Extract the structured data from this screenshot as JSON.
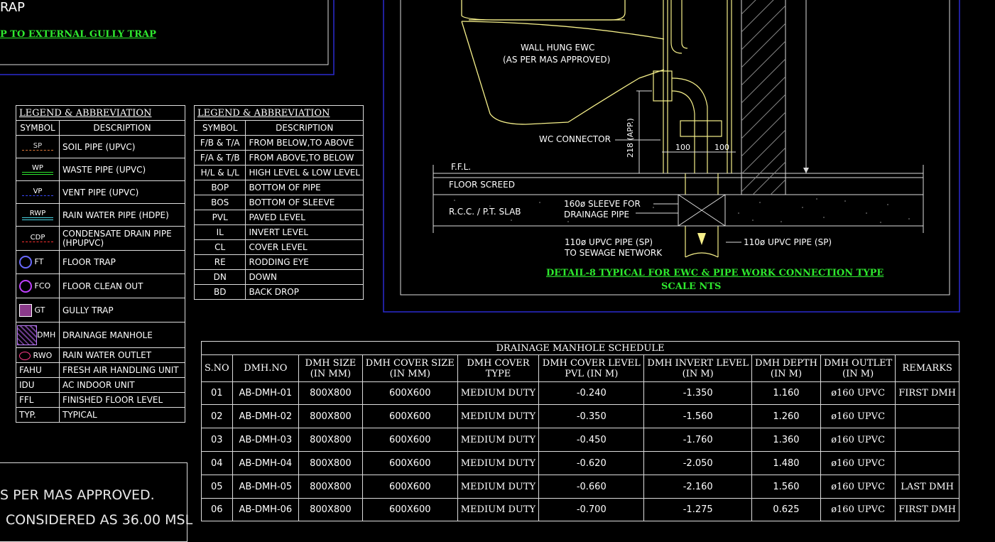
{
  "top_left": {
    "title_fragment": "RAP",
    "link_text": "P TO EXTERNAL GULLY TRAP"
  },
  "legend1": {
    "title": "LEGEND & ABBREVIATION",
    "col_symbol": "SYMBOL",
    "col_description": "DESCRIPTION",
    "rows": [
      {
        "symbol": "SP",
        "description": "SOIL PIPE (UPVC)"
      },
      {
        "symbol": "WP",
        "description": "WASTE PIPE (UPVC)"
      },
      {
        "symbol": "VP",
        "description": "VENT PIPE (UPVC)"
      },
      {
        "symbol": "RWP",
        "description": "RAIN WATER PIPE (HDPE)"
      },
      {
        "symbol": "CDP",
        "description": "CONDENSATE DRAIN PIPE (HPUPVC)"
      },
      {
        "symbol": "FT",
        "description": "FLOOR TRAP"
      },
      {
        "symbol": "FCO",
        "description": "FLOOR CLEAN OUT"
      },
      {
        "symbol": "GT",
        "description": "GULLY TRAP"
      },
      {
        "symbol": "DMH",
        "description": "DRAINAGE MANHOLE"
      },
      {
        "symbol": "RWO",
        "description": "RAIN WATER OUTLET"
      },
      {
        "symbol": "FAHU",
        "description": "FRESH AIR HANDLING UNIT"
      },
      {
        "symbol": "IDU",
        "description": "AC INDOOR UNIT"
      },
      {
        "symbol": "FFL",
        "description": "FINISHED FLOOR LEVEL"
      },
      {
        "symbol": "TYP.",
        "description": "TYPICAL"
      }
    ]
  },
  "legend2": {
    "title": "LEGEND & ABBREVIATION",
    "col_symbol": "SYMBOL",
    "col_description": "DESCRIPTION",
    "rows": [
      {
        "symbol": "F/B & T/A",
        "description": "FROM BELOW,TO ABOVE"
      },
      {
        "symbol": "F/A & T/B",
        "description": "FROM ABOVE,TO BELOW"
      },
      {
        "symbol": "H/L & L/L",
        "description": "HIGH LEVEL & LOW LEVEL"
      },
      {
        "symbol": "BOP",
        "description": "BOTTOM OF PIPE"
      },
      {
        "symbol": "BOS",
        "description": "BOTTOM OF SLEEVE"
      },
      {
        "symbol": "PVL",
        "description": "PAVED LEVEL"
      },
      {
        "symbol": "IL",
        "description": "INVERT LEVEL"
      },
      {
        "symbol": "CL",
        "description": "COVER LEVEL"
      },
      {
        "symbol": "RE",
        "description": "RODDING EYE"
      },
      {
        "symbol": "DN",
        "description": "DOWN"
      },
      {
        "symbol": "BD",
        "description": "BACK DROP"
      }
    ]
  },
  "detail": {
    "wall_hung_label_1": "WALL HUNG EWC",
    "wall_hung_label_2": "(AS PER MAS APPROVED)",
    "wc_connector": "WC CONNECTOR",
    "dim_vertical": "218 (APP.)",
    "dim_100_a": "100",
    "dim_100_b": "100",
    "ffl": "F.F.L.",
    "floor_screed": "FLOOR SCREED",
    "slab": "R.C.C. / P.T. SLAB",
    "sleeve_1": "160ø SLEEVE FOR",
    "sleeve_2": "DRAINAGE PIPE",
    "pipe_left_1": "110ø UPVC PIPE (SP)",
    "pipe_left_2": "TO SEWAGE NETWORK",
    "pipe_right": "110ø UPVC PIPE (SP)",
    "title": "DETAIL-8 TYPICAL FOR EWC & PIPE WORK CONNECTION TYPE",
    "scale": "SCALE NTS"
  },
  "schedule": {
    "title": "DRAINAGE MANHOLE SCHEDULE",
    "headers": [
      "S.NO",
      "DMH.NO",
      "DMH SIZE\n(IN MM)",
      "DMH COVER SIZE\n(IN MM)",
      "DMH COVER\nTYPE",
      "DMH COVER LEVEL\nPVL (IN M)",
      "DMH INVERT LEVEL\n(IN M)",
      "DMH DEPTH\n(IN M)",
      "DMH OUTLET\n(IN M)",
      "REMARKS"
    ],
    "rows": [
      [
        "01",
        "AB-DMH-01",
        "800X800",
        "600X600",
        "MEDIUM DUTY",
        "-0.240",
        "-1.350",
        "1.160",
        "ø160 UPVC",
        "FIRST DMH"
      ],
      [
        "02",
        "AB-DMH-02",
        "800X800",
        "600X600",
        "MEDIUM DUTY",
        "-0.350",
        "-1.560",
        "1.260",
        "ø160 UPVC",
        ""
      ],
      [
        "03",
        "AB-DMH-03",
        "800X800",
        "600X600",
        "MEDIUM DUTY",
        "-0.450",
        "-1.760",
        "1.360",
        "ø160 UPVC",
        ""
      ],
      [
        "04",
        "AB-DMH-04",
        "800X800",
        "600X600",
        "MEDIUM DUTY",
        "-0.620",
        "-2.050",
        "1.480",
        "ø160 UPVC",
        ""
      ],
      [
        "05",
        "AB-DMH-05",
        "800X800",
        "600X600",
        "MEDIUM DUTY",
        "-0.660",
        "-2.160",
        "1.560",
        "ø160 UPVC",
        "LAST DMH"
      ],
      [
        "06",
        "AB-DMH-06",
        "800X800",
        "600X600",
        "MEDIUM DUTY",
        "-0.700",
        "-1.275",
        "0.625",
        "ø160 UPVC",
        "FIRST DMH"
      ]
    ]
  },
  "notes": {
    "line1": "S PER MAS APPROVED.",
    "line2": "CONSIDERED AS 36.00 MSL"
  },
  "colors": {
    "background": "#000000",
    "frame_blue": "#2a2ad0",
    "green_text": "#2ee82e",
    "yellow_lines": "#f6f08a",
    "white_lines": "#dddddd"
  }
}
